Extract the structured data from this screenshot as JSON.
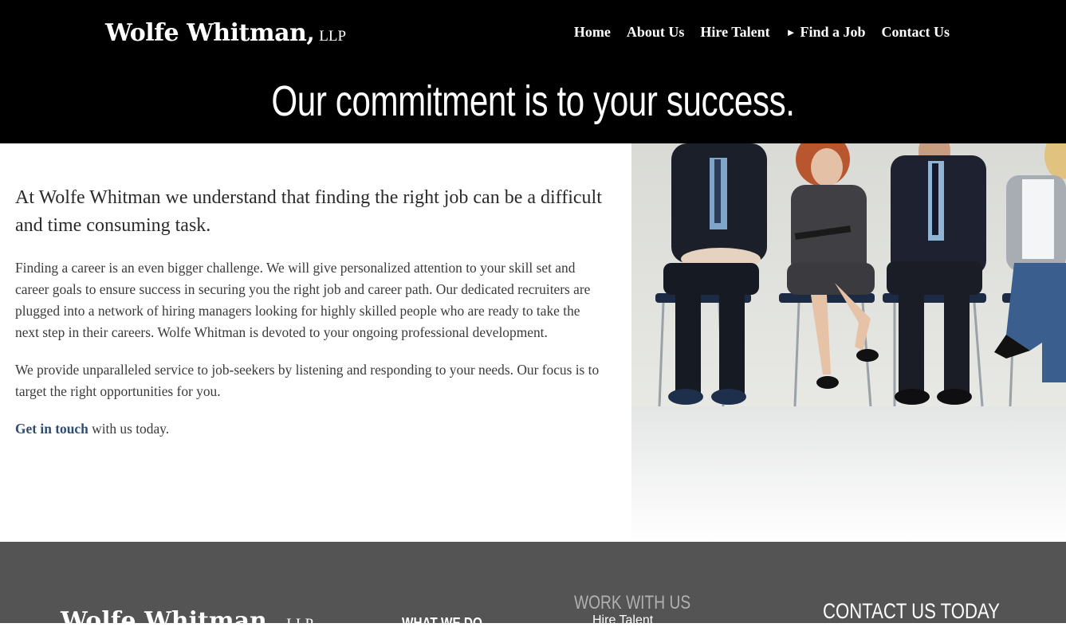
{
  "header": {
    "brand_name": "Wolfe Whitman,",
    "brand_suffix": "LLP",
    "nav": [
      {
        "label": "Home"
      },
      {
        "label": "About Us"
      },
      {
        "label": "Hire Talent"
      },
      {
        "label": "Find a Job",
        "active_arrow": "►"
      },
      {
        "label": "Contact Us"
      }
    ],
    "tagline": "Our commitment is to your success."
  },
  "main": {
    "lead": "At Wolfe Whitman we understand that finding the right job can be a difficult and time consuming task.",
    "paragraph1": "Finding a career is an even bigger challenge.  We will give personalized attention to your skill set and career goals to ensure success in securing you the right job and career path.  Our dedicated recruiters are plugged into a network of hiring managers looking for highly skilled people who are ready to take the next step in their careers.  Wolfe Whitman is devoted to your ongoing professional development.",
    "paragraph2": "We provide unparalleled service to job-seekers by listening and responding to your needs.  Our focus is to target the right opportunities for you.",
    "cta_link": "Get in touch",
    "cta_rest": " with us today."
  },
  "photo": {
    "alt": "People waiting in chairs for job interviews"
  },
  "footer": {
    "brand_name": "Wolfe Whitman,",
    "brand_suffix": "LLP",
    "what_we_do": "WHAT WE DO",
    "work_with_us": "WORK WITH US",
    "hire_talent": "Hire Talent",
    "contact_heading": "CONTACT US TODAY"
  },
  "colors": {
    "header_bg": "#000000",
    "footer_bg": "#545454",
    "link": "#2f4d6e"
  }
}
